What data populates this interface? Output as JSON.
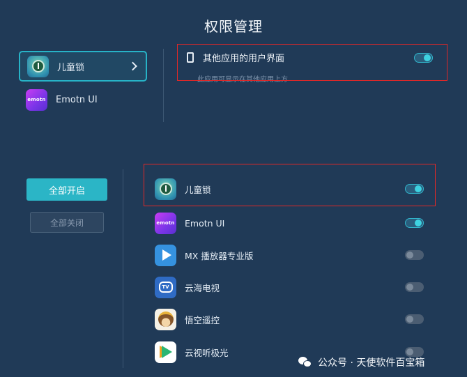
{
  "page": {
    "title": "权限管理"
  },
  "top_apps": [
    {
      "label": "儿童锁",
      "icon": "child-lock-icon",
      "selected": true
    },
    {
      "label": "Emotn UI",
      "icon": "emotn-ui-icon",
      "selected": false
    }
  ],
  "permission": {
    "title": "其他应用的用户界面",
    "description": "此应用可显示在其他应用上方",
    "enabled": true
  },
  "buttons": {
    "all_on": "全部开启",
    "all_off": "全部关闭"
  },
  "app_list": [
    {
      "label": "儿童锁",
      "icon": "child-lock-icon",
      "enabled": true
    },
    {
      "label": "Emotn UI",
      "icon": "emotn-ui-icon",
      "enabled": true
    },
    {
      "label": "MX 播放器专业版",
      "icon": "mx-player-icon",
      "enabled": false
    },
    {
      "label": "云海电视",
      "icon": "yunhai-tv-icon",
      "enabled": false
    },
    {
      "label": "悟空遥控",
      "icon": "wukong-remote-icon",
      "enabled": false
    },
    {
      "label": "云视听极光",
      "icon": "yunshiting-jiguang-icon",
      "enabled": false
    }
  ],
  "icon_text": {
    "emotn": "emotn",
    "tv": "TV"
  },
  "watermark": {
    "text": "公众号 · 天使软件百宝箱"
  },
  "colors": {
    "background": "#203a57",
    "accent": "#2bb5c6",
    "highlight_box": "#e02828"
  }
}
